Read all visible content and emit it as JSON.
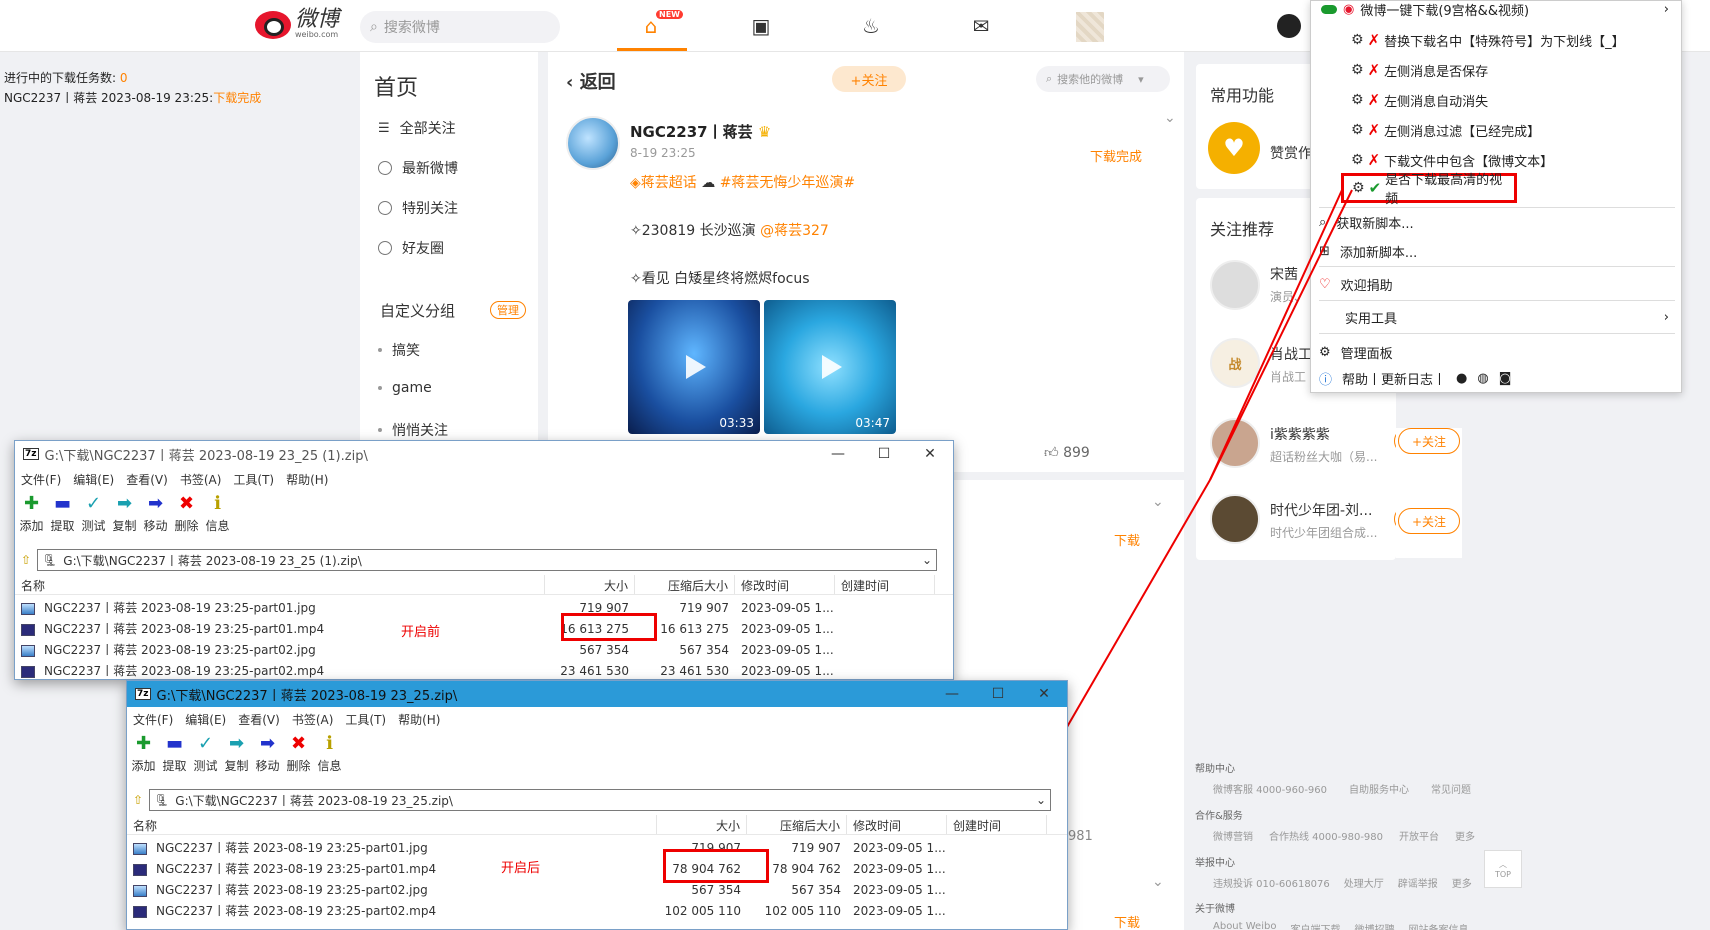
{
  "topbar": {
    "logo_text": "微博",
    "logo_sub": "weibo.com",
    "search_placeholder": "搜索微博",
    "new_badge": "NEW"
  },
  "status": {
    "tasks_label": "进行中的下载任务数: ",
    "tasks_count": "0",
    "task_line": "NGC2237丨蒋芸 2023-08-19 23:25:",
    "task_done": "下载完成"
  },
  "leftnav": {
    "title": "首页",
    "items": [
      "全部关注",
      "最新微博",
      "特别关注",
      "好友圈"
    ],
    "group_title": "自定义分组",
    "manage": "管理",
    "groups": [
      "搞笑",
      "game",
      "悄悄关注"
    ]
  },
  "feed": {
    "back": "返回",
    "follow": "+关注",
    "search_placeholder": "搜索他的微博",
    "post": {
      "name": "NGC2237丨蒋芸",
      "time": "8-19 23:25",
      "status": "下载完成",
      "tag1": "蒋芸超话",
      "tag2": "#蒋芸无悔少年巡演#",
      "line1_prefix": "✧230819 长沙巡演 ",
      "line1_mention": "@蒋芸327",
      "line2": "✧看见 白矮星终将燃烬focus",
      "video1_duration": "03:33",
      "video2_duration": "03:47",
      "likes": "899"
    },
    "post2_status": "下载",
    "post3_status": "下载",
    "count_981": "981"
  },
  "rightcol": {
    "common_title": "常用功能",
    "reward": "赞赏作",
    "recommend_title": "关注推荐",
    "recs": [
      {
        "name": "宋茜",
        "sub": "演员、"
      },
      {
        "name": "肖战工",
        "sub": "肖战工"
      },
      {
        "name": "i紫紫紫紫",
        "sub": "超话粉丝大咖（易..."
      },
      {
        "name": "时代少年团-刘...",
        "sub": "时代少年团组合成..."
      }
    ],
    "follow_btn": "+关注"
  },
  "footer": {
    "help": "帮助中心",
    "help_links": [
      "微博客服 4000-960-960",
      "自助服务中心",
      "常见问题"
    ],
    "coop": "合作&服务",
    "coop_links": [
      "微博营销",
      "合作热线 4000-980-980",
      "开放平台",
      "更多"
    ],
    "report": "举报中心",
    "report_links": [
      "违规投诉 010-60618076",
      "处理大厅",
      "辟谣举报",
      "更多"
    ],
    "about": "关于微博",
    "about_links": [
      "About Weibo",
      "客户端下载",
      "微博招聘",
      "网站备案信息"
    ],
    "top": "TOP"
  },
  "menu": {
    "header": "微博一键下载(9宫格&&视频)",
    "options": [
      "替换下载名中【特殊符号】为下划线【_】",
      "左侧消息是否保存",
      "左侧消息自动消失",
      "左侧消息过滤【已经完成】",
      "下载文件中包含【微博文本】"
    ],
    "highlight_option": "是否下载最高清的视频",
    "items": [
      "获取新脚本...",
      "添加新脚本...",
      "欢迎捐助",
      "实用工具",
      "管理面板"
    ],
    "help_line": "帮助丨更新日志丨"
  },
  "win1": {
    "title": "G:\\下载\\NGC2237丨蒋芸 2023-08-19 23_25 (1).zip\\",
    "path": "G:\\下载\\NGC2237丨蒋芸 2023-08-19 23_25 (1).zip\\",
    "rows": [
      {
        "name": "NGC2237丨蒋芸 2023-08-19 23:25-part01.jpg",
        "size": "719 907",
        "packed": "719 907",
        "modified": "2023-09-05 1...",
        "type": "jpg"
      },
      {
        "name": "NGC2237丨蒋芸 2023-08-19 23:25-part01.mp4",
        "size": "16 613 275",
        "packed": "16 613 275",
        "modified": "2023-09-05 1...",
        "type": "mp4"
      },
      {
        "name": "NGC2237丨蒋芸 2023-08-19 23:25-part02.jpg",
        "size": "567 354",
        "packed": "567 354",
        "modified": "2023-09-05 1...",
        "type": "jpg"
      },
      {
        "name": "NGC2237丨蒋芸 2023-08-19 23:25-part02.mp4",
        "size": "23 461 530",
        "packed": "23 461 530",
        "modified": "2023-09-05 1...",
        "type": "mp4"
      }
    ],
    "annotation": "开启前"
  },
  "win2": {
    "title": "G:\\下载\\NGC2237丨蒋芸 2023-08-19 23_25.zip\\",
    "path": "G:\\下载\\NGC2237丨蒋芸 2023-08-19 23_25.zip\\",
    "rows": [
      {
        "name": "NGC2237丨蒋芸 2023-08-19 23:25-part01.jpg",
        "size": "719 907",
        "packed": "719 907",
        "modified": "2023-09-05 1...",
        "type": "jpg"
      },
      {
        "name": "NGC2237丨蒋芸 2023-08-19 23:25-part01.mp4",
        "size": "78 904 762",
        "packed": "78 904 762",
        "modified": "2023-09-05 1...",
        "type": "mp4"
      },
      {
        "name": "NGC2237丨蒋芸 2023-08-19 23:25-part02.jpg",
        "size": "567 354",
        "packed": "567 354",
        "modified": "2023-09-05 1...",
        "type": "jpg"
      },
      {
        "name": "NGC2237丨蒋芸 2023-08-19 23:25-part02.mp4",
        "size": "102 005 110",
        "packed": "102 005 110",
        "modified": "2023-09-05 1...",
        "type": "mp4"
      }
    ],
    "annotation": "开启后"
  },
  "zip": {
    "menus": [
      "文件(F)",
      "编辑(E)",
      "查看(V)",
      "书签(A)",
      "工具(T)",
      "帮助(H)"
    ],
    "tools": [
      "添加",
      "提取",
      "测试",
      "复制",
      "移动",
      "删除",
      "信息"
    ],
    "headers": [
      "名称",
      "大小",
      "压缩后大小",
      "修改时间",
      "创建时间"
    ]
  },
  "colors": {
    "accent": "#ff8200",
    "annotation": "#e00000",
    "zip_active": "#2b9ad8"
  }
}
